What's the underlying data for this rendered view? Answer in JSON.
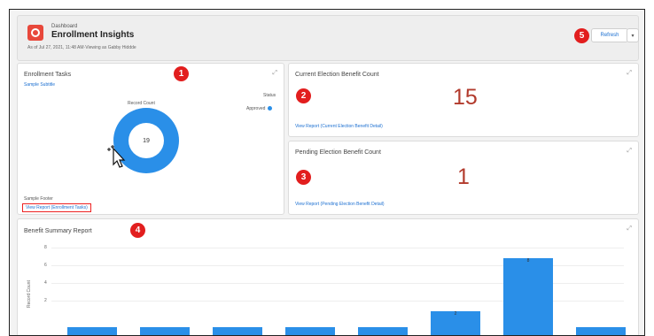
{
  "header": {
    "breadcrumb": "Dashboard",
    "title": "Enrollment Insights",
    "as_of": "As of Jul 27, 2021, 11:48 AM·Viewing as Gabby Hiddde",
    "refresh_label": "Refresh",
    "dropdown_icon": "chevron-down-icon"
  },
  "badges": [
    "1",
    "2",
    "3",
    "4",
    "5"
  ],
  "enrollment_tasks": {
    "title": "Enrollment Tasks",
    "subtitle": "Sample Subtitle",
    "record_count_label": "Record Count",
    "status_label": "Status",
    "approved_label": "Approved",
    "total": "19",
    "footer": "Sample Footer",
    "view_report": "View Report (Enrollment Tasks)",
    "approved_color": "#2a8fe8"
  },
  "current_election": {
    "title": "Current Election Benefit Count",
    "value": "15",
    "view_report": "View Report (Current Election Benefit Detail)"
  },
  "pending_election": {
    "title": "Pending Election Benefit Count",
    "value": "1",
    "view_report": "View Report (Pending Election Benefit Detail)"
  },
  "benefit_summary": {
    "title": "Benefit Summary Report",
    "ylabel": "Record Count",
    "chart_data": {
      "type": "bar",
      "ylabel": "Record Count",
      "ylim": [
        0,
        8
      ],
      "yticks": [
        "8",
        "6",
        "4",
        "2"
      ],
      "values": [
        0,
        0,
        0,
        0,
        0,
        2,
        8,
        0
      ],
      "value_labels": [
        "",
        "",
        "",
        "",
        "",
        "2",
        "8",
        ""
      ],
      "bar_color": "#2a8fe8"
    }
  }
}
